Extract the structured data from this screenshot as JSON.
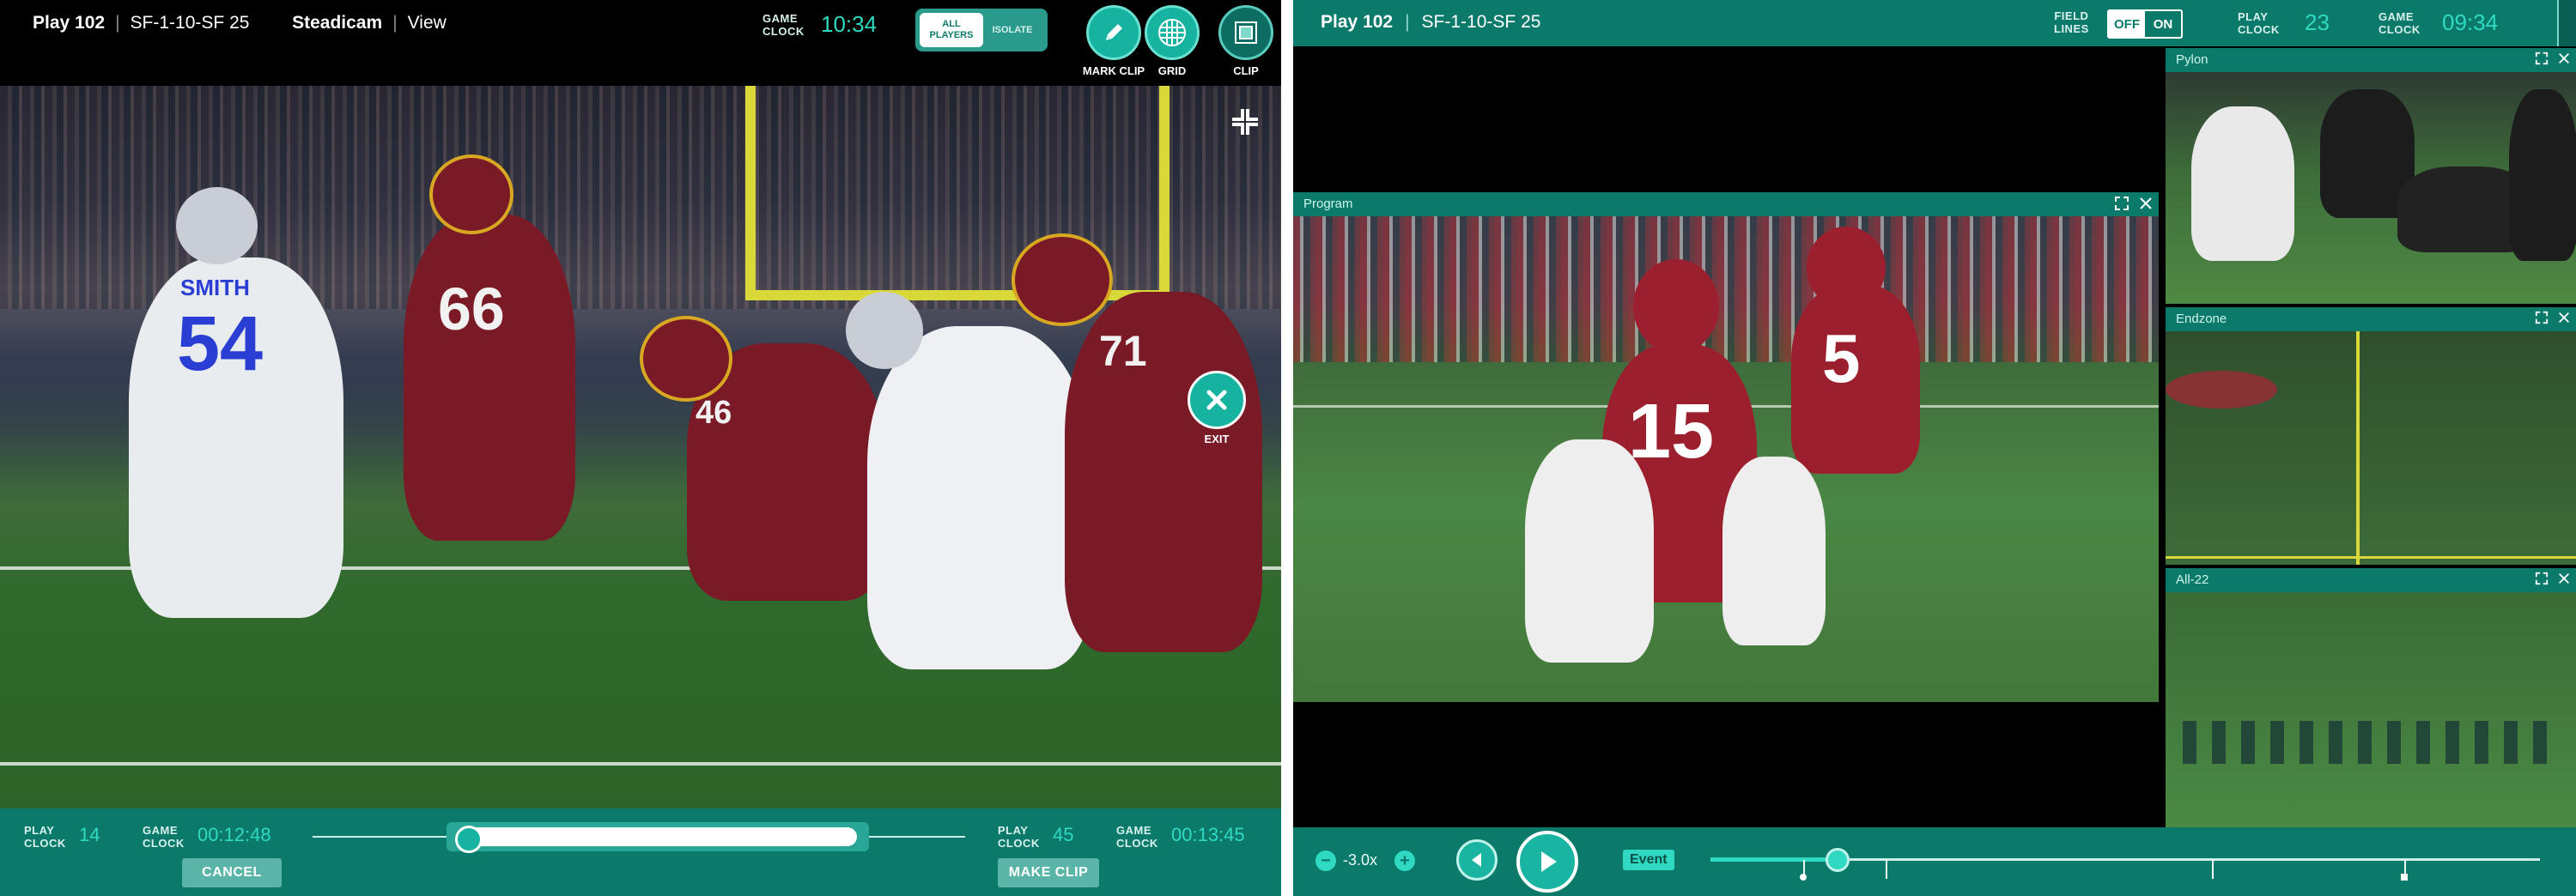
{
  "left": {
    "header": {
      "play": "Play 102",
      "situation": "SF-1-10-SF 25",
      "camera": "Steadicam",
      "view_label": "View",
      "game_clock_caption": [
        "GAME",
        "CLOCK"
      ],
      "game_clock": "10:34",
      "players_toggle": {
        "selected_lines": [
          "ALL",
          "PLAYERS"
        ],
        "other": "ISOLATE"
      },
      "tools": {
        "mark_clip": "MARK CLIP",
        "grid": "GRID",
        "clip": "CLIP"
      }
    },
    "video": {
      "jerseys": [
        "SMITH",
        "54",
        "66",
        "46",
        "71"
      ],
      "exit_label": "EXIT"
    },
    "footer": {
      "start": {
        "play_clock_caption": [
          "PLAY",
          "CLOCK"
        ],
        "play_clock": "14",
        "game_clock_caption": [
          "GAME",
          "CLOCK"
        ],
        "game_clock": "00:12:48"
      },
      "end": {
        "play_clock_caption": [
          "PLAY",
          "CLOCK"
        ],
        "play_clock": "45",
        "game_clock_caption": [
          "GAME",
          "CLOCK"
        ],
        "game_clock": "00:13:45"
      },
      "cancel_label": "CANCEL",
      "make_clip_label": "MAKE CLIP"
    }
  },
  "right": {
    "header": {
      "play": "Play 102",
      "situation": "SF-1-10-SF 25",
      "field_lines_caption": [
        "FIELD",
        "LINES"
      ],
      "field_lines_off": "OFF",
      "field_lines_on": "ON",
      "play_clock_caption": [
        "PLAY",
        "CLOCK"
      ],
      "play_clock": "23",
      "game_clock_caption": [
        "GAME",
        "CLOCK"
      ],
      "game_clock": "09:34"
    },
    "panes": {
      "program": "Program",
      "pylon": "Pylon",
      "endzone": "Endzone",
      "all22": "All-22"
    },
    "program_video": {
      "jerseys": [
        "15",
        "5"
      ]
    },
    "controls": {
      "speed": "-3.0x",
      "event_label": "Event"
    }
  },
  "colors": {
    "accent_teal": "#0c7a6b",
    "highlight_cyan": "#2fd9c2",
    "button_teal": "#17b3a1"
  }
}
